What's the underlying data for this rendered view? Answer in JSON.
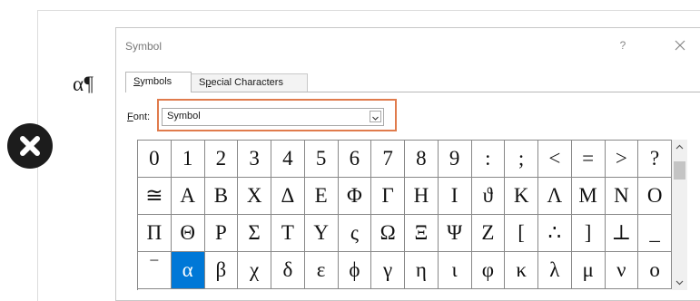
{
  "document": {
    "text": "α¶"
  },
  "dialog": {
    "title": "Symbol",
    "help_label": "?",
    "tabs": [
      {
        "label_underlined": "S",
        "label_rest": "ymbols",
        "active": true
      },
      {
        "label_pre": "S",
        "label_underlined": "p",
        "label_rest": "ecial Characters",
        "active": false
      }
    ],
    "font": {
      "label_underlined": "F",
      "label_rest": "ont:",
      "value": "Symbol"
    },
    "symbols": [
      "0",
      "1",
      "2",
      "3",
      "4",
      "5",
      "6",
      "7",
      "8",
      "9",
      ":",
      ";",
      "<",
      "=",
      ">",
      "?",
      "≅",
      "Α",
      "Β",
      "Χ",
      "Δ",
      "Ε",
      "Φ",
      "Γ",
      "Η",
      "Ι",
      "ϑ",
      "Κ",
      "Λ",
      "Μ",
      "Ν",
      "Ο",
      "Π",
      "Θ",
      "Ρ",
      "Σ",
      "Τ",
      "Υ",
      "ς",
      "Ω",
      "Ξ",
      "Ψ",
      "Ζ",
      "[",
      "∴",
      "]",
      "⊥",
      "_",
      "‾",
      "α",
      "β",
      "χ",
      "δ",
      "ε",
      "ϕ",
      "γ",
      "η",
      "ι",
      "φ",
      "κ",
      "λ",
      "μ",
      "ν",
      "ο"
    ],
    "selected_index": 49
  },
  "colors": {
    "selection": "#0078d7",
    "highlight_box": "#e07b4c"
  }
}
